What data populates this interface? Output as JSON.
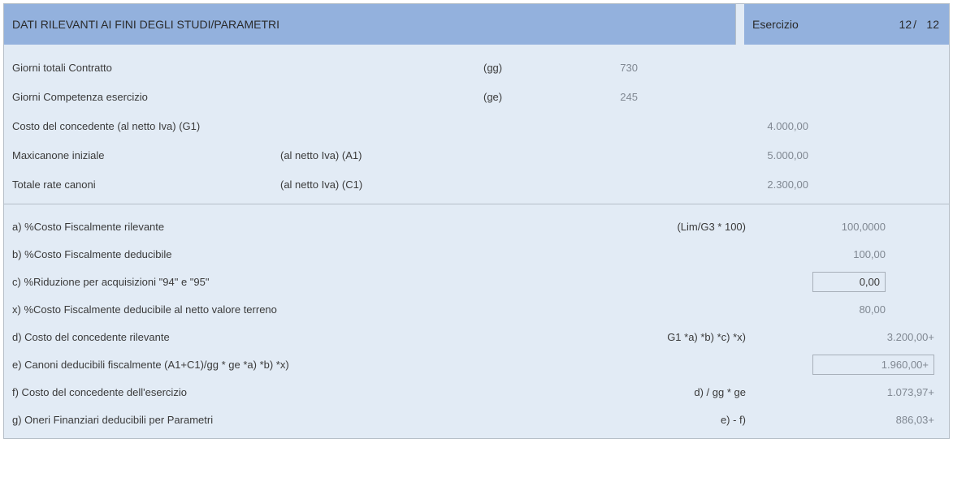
{
  "header": {
    "title": "DATI RILEVANTI AI FINI DEGLI STUDI/PARAMETRI",
    "exercise_label": "Esercizio",
    "exercise_current": "12",
    "exercise_sep": "/",
    "exercise_total": "12"
  },
  "top": {
    "gg_label": "Giorni totali Contratto",
    "gg_unit": "(gg)",
    "gg_val": "730",
    "ge_label": "Giorni Competenza esercizio",
    "ge_unit": "(ge)",
    "ge_val": "245",
    "g1_label": "Costo del concedente (al netto Iva) (G1)",
    "g1_val": "4.000,00",
    "a1_label": "Maxicanone iniziale",
    "a1_note": "(al netto Iva) (A1)",
    "a1_val": "5.000,00",
    "c1_label": "Totale rate canoni",
    "c1_note": "(al netto Iva) (C1)",
    "c1_val": "2.300,00"
  },
  "bottom": {
    "a_label": "a) %Costo Fiscalmente rilevante",
    "a_formula": "(Lim/G3 * 100)",
    "a_val": "100,0000",
    "b_label": "b) %Costo Fiscalmente deducibile",
    "b_val": "100,00",
    "c_label": "c) %Riduzione per acquisizioni \"94\" e \"95\"",
    "c_val": "0,00",
    "x_label": "x) %Costo Fiscalmente deducibile al netto valore terreno",
    "x_val": "80,00",
    "d_label": "d) Costo del concedente rilevante",
    "d_formula": "G1 *a) *b) *c) *x)",
    "d_val": "3.200,00+",
    "e_label": "e) Canoni deducibili fiscalmente (A1+C1)/gg * ge *a) *b) *x)",
    "e_val": "1.960,00+",
    "f_label": "f) Costo del concedente dell'esercizio",
    "f_formula": "d) / gg * ge",
    "f_val": "1.073,97+",
    "g_label": "g) Oneri Finanziari deducibili per Parametri",
    "g_formula": "e) - f)",
    "g_val": "886,03+"
  }
}
